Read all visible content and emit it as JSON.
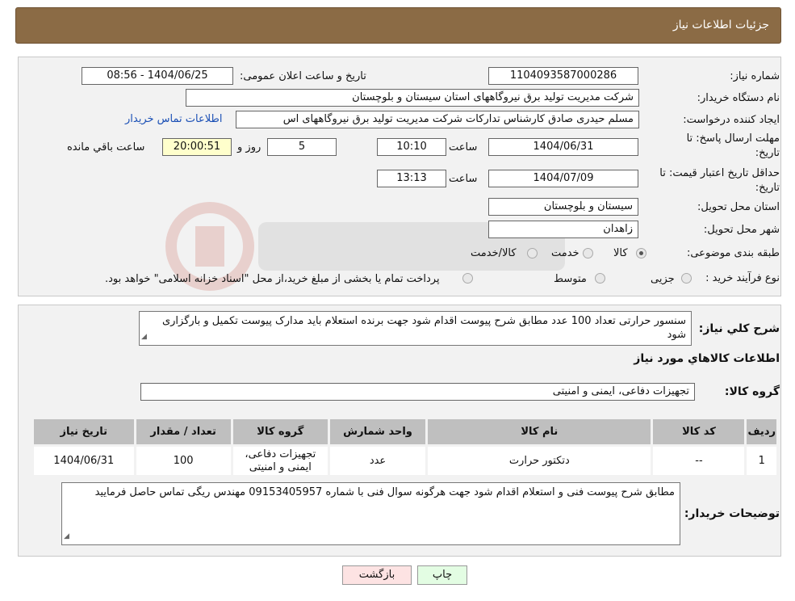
{
  "header": {
    "title": "جزئیات اطلاعات نیاز"
  },
  "form": {
    "need_number_label": "شماره نیاز:",
    "need_number": "1104093587000286",
    "announce_label": "تاریخ و ساعت اعلان عمومی:",
    "announce_value": "1404/06/25 - 08:56",
    "buyer_label": "نام دستگاه خریدار:",
    "buyer_value": "شرکت مدیریت تولید برق نیروگاههای استان سیستان و بلوچستان",
    "creator_label": "ایجاد کننده درخواست:",
    "creator_value": "مسلم حیدری صادق کارشناس تدارکات شرکت مدیریت تولید برق نیروگاههای اس",
    "contact_link": "اطلاعات تماس خریدار",
    "deadline_label_1": "مهلت ارسال پاسخ: تا",
    "deadline_label_2": "تاریخ:",
    "deadline_date": "1404/06/31",
    "time_label": "ساعت",
    "deadline_time": "10:10",
    "days_value": "5",
    "days_label": "روز و",
    "remaining_time": "20:00:51",
    "remaining_label": "ساعت باقي مانده",
    "validity_label_1": "حداقل تاریخ اعتبار قیمت: تا",
    "validity_label_2": "تاریخ:",
    "validity_date": "1404/07/09",
    "validity_time": "13:13",
    "province_label": "استان محل تحویل:",
    "province_value": "سیستان و بلوچستان",
    "city_label": "شهر محل تحویل:",
    "city_value": "زاهدان",
    "category_label": "طبقه بندی موضوعی:",
    "category_options": [
      "کالا",
      "خدمت",
      "کالا/خدمت"
    ],
    "category_selected": 0,
    "process_label": "نوع فرآیند خرید :",
    "process_options": [
      "جزیی",
      "متوسط"
    ],
    "process_note": "پرداخت تمام یا بخشی از مبلغ خرید،از محل \"اسناد خزانه اسلامی\" خواهد بود."
  },
  "description": {
    "label": "شرح کلي نياز:",
    "text": "سنسور حرارتی  تعداد  100 عدد   مطابق شرح پیوست اقدام شود  جهت برنده استعلام باید مدارک پیوست تکمیل و بارگزاری شود"
  },
  "goods": {
    "section_title": "اطلاعات کالاهاي مورد نياز",
    "group_label": "گروه کالا:",
    "group_value": "تجهیزات دفاعی، ایمنی و امنیتی",
    "columns": [
      "رديف",
      "کد کالا",
      "نام کالا",
      "واحد شمارش",
      "گروه کالا",
      "تعداد / مقدار",
      "تاريخ نياز"
    ],
    "rows": [
      [
        "1",
        "--",
        "دتکتور حرارت",
        "عدد",
        "تجهیزات دفاعی، ایمنی و امنیتی",
        "100",
        "1404/06/31"
      ]
    ]
  },
  "buyer_notes": {
    "label": "توضیحات خریدار:",
    "text": "مطابق شرح پیوست فنی و استعلام  اقدام شود جهت هرگونه سوال فنی با شماره 09153405957  مهندس ریگی  تماس حاصل فرمایید"
  },
  "buttons": {
    "print": "چاپ",
    "back": "بازگشت"
  },
  "colors": {
    "header": "#8b6b45",
    "panel": "#f2f2f2",
    "link": "#1a4fb5",
    "back_btn": "#fde3e3",
    "print_btn": "#e3fde3"
  }
}
